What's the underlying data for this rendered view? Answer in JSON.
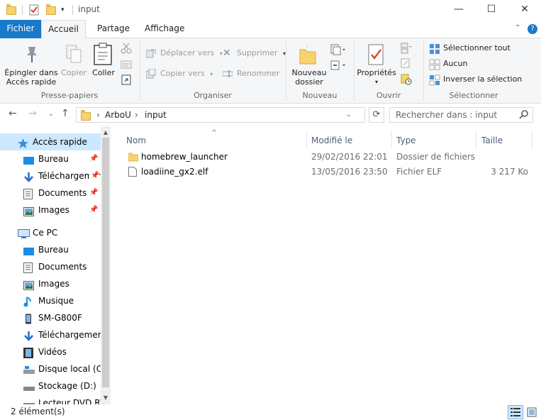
{
  "window": {
    "title": "input",
    "controls": {
      "minimize": "—",
      "maximize": "☐",
      "close": "✕"
    }
  },
  "tabs": {
    "file": "Fichier",
    "home": "Accueil",
    "share": "Partage",
    "view": "Affichage",
    "collapse_icon": "chevron-up-icon",
    "help_icon": "help-icon",
    "help_glyph": "?"
  },
  "ribbon": {
    "clipboard": {
      "label": "Presse-papiers",
      "pin_quick": "Épingler dans\nAccès rapide",
      "pin_line1": "Épingler dans",
      "pin_line2": "Accès rapide",
      "copy": "Copier",
      "paste": "Coller"
    },
    "organize": {
      "label": "Organiser",
      "move_to": "Déplacer vers",
      "copy_to": "Copier vers",
      "delete": "Supprimer",
      "rename": "Renommer"
    },
    "new": {
      "label": "Nouveau",
      "new_folder_line1": "Nouveau",
      "new_folder_line2": "dossier"
    },
    "open": {
      "label": "Ouvrir",
      "properties": "Propriétés"
    },
    "select": {
      "label": "Sélectionner",
      "select_all": "Sélectionner tout",
      "select_none": "Aucun",
      "invert": "Inverser la sélection"
    }
  },
  "address": {
    "parts": [
      "ArboU",
      "input"
    ],
    "separator": "›",
    "search_placeholder": "Rechercher dans : input"
  },
  "navpane": {
    "quick_access": "Accès rapide",
    "quick_items": [
      {
        "label": "Bureau",
        "icon": "desktop-icon"
      },
      {
        "label": "Téléchargements",
        "icon": "download-icon"
      },
      {
        "label": "Documents",
        "icon": "documents-icon"
      },
      {
        "label": "Images",
        "icon": "images-icon"
      }
    ],
    "this_pc": "Ce PC",
    "pc_items": [
      {
        "label": "Bureau",
        "icon": "desktop-icon"
      },
      {
        "label": "Documents",
        "icon": "documents-icon"
      },
      {
        "label": "Images",
        "icon": "images-icon"
      },
      {
        "label": "Musique",
        "icon": "music-icon"
      },
      {
        "label": "SM-G800F",
        "icon": "phone-icon"
      },
      {
        "label": "Téléchargements",
        "icon": "download-icon"
      },
      {
        "label": "Vidéos",
        "icon": "videos-icon"
      },
      {
        "label": "Disque local (C:)",
        "icon": "local-disk-icon"
      },
      {
        "label": "Stockage (D:)",
        "icon": "drive-icon"
      },
      {
        "label": "Lecteur DVD RW",
        "icon": "dvd-drive-icon"
      }
    ]
  },
  "filelist": {
    "columns": {
      "name": "Nom",
      "modified": "Modifié le",
      "type": "Type",
      "size": "Taille"
    },
    "rows": [
      {
        "name": "homebrew_launcher",
        "modified": "29/02/2016 22:01",
        "type": "Dossier de fichiers",
        "size": "",
        "icon": "folder-icon"
      },
      {
        "name": "loadiine_gx2.elf",
        "modified": "13/05/2016 23:50",
        "type": "Fichier ELF",
        "size": "3 217 Ko",
        "icon": "file-icon"
      }
    ]
  },
  "status": {
    "count": "2 élément(s)"
  },
  "colors": {
    "accent": "#1979ca",
    "selection": "#cce8ff",
    "folder": "#f7d46b"
  }
}
